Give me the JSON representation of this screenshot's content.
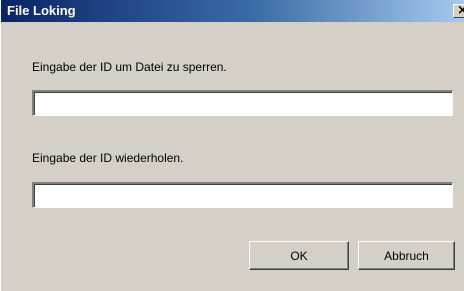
{
  "window": {
    "title": "File Loking",
    "close_glyph": "×",
    "close_icon": "close-icon"
  },
  "form": {
    "id_label": "Eingabe der ID um Datei zu sperren.",
    "id_value": "",
    "repeat_label": "Eingabe der ID wiederholen.",
    "repeat_value": ""
  },
  "buttons": {
    "ok_label": "OK",
    "cancel_label": "Abbruch"
  },
  "colors": {
    "face": "#d4d0c8",
    "title_start": "#0a246a",
    "title_end": "#a6caf0",
    "title_text": "#ffffff"
  }
}
